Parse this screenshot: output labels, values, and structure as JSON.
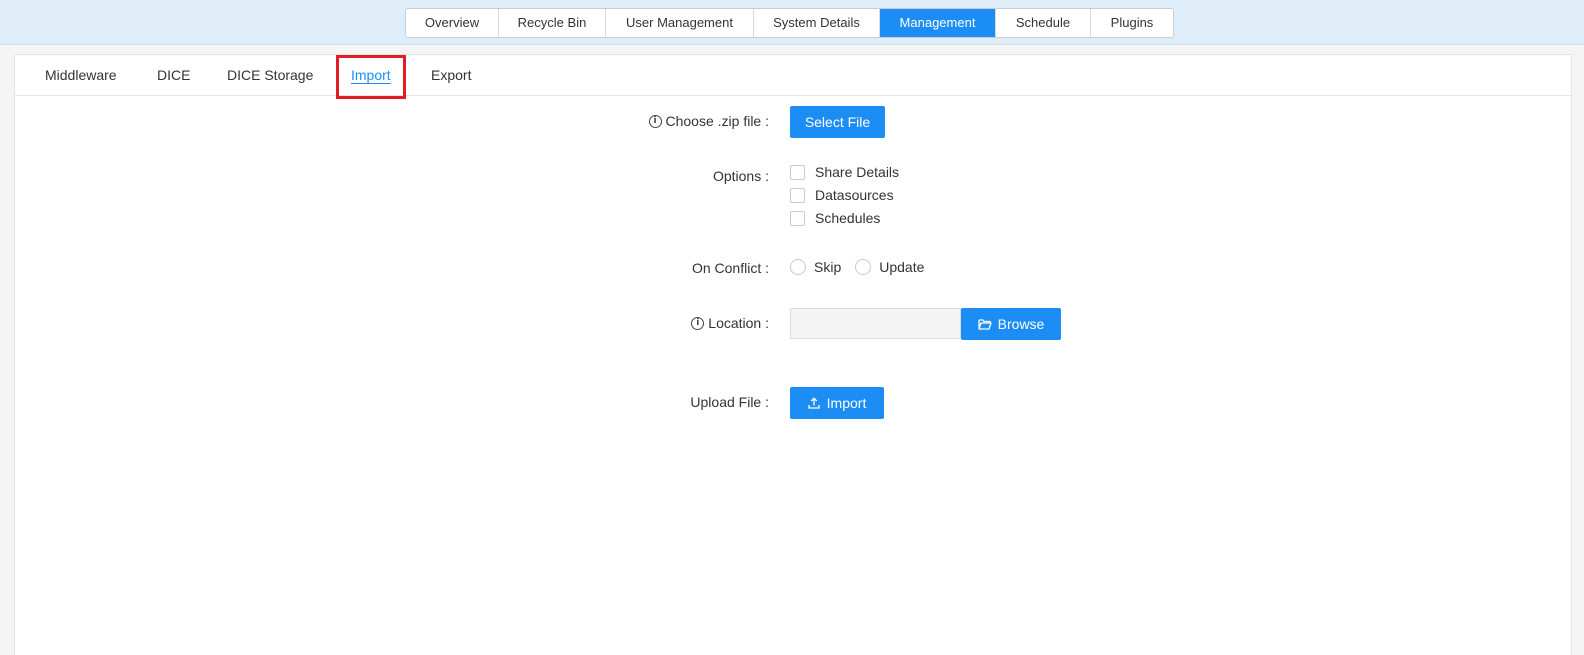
{
  "top_tabs": [
    {
      "label": "Overview"
    },
    {
      "label": "Recycle Bin"
    },
    {
      "label": "User Management"
    },
    {
      "label": "System Details"
    },
    {
      "label": "Management",
      "active": true
    },
    {
      "label": "Schedule"
    },
    {
      "label": "Plugins"
    }
  ],
  "sub_tabs": [
    {
      "label": "Middleware"
    },
    {
      "label": "DICE"
    },
    {
      "label": "DICE Storage"
    },
    {
      "label": "Import",
      "active": true
    },
    {
      "label": "Export"
    }
  ],
  "form": {
    "choose_zip": {
      "label": "Choose .zip file :",
      "button": "Select File"
    },
    "options": {
      "label": "Options :",
      "items": [
        "Share Details",
        "Datasources",
        "Schedules"
      ]
    },
    "on_conflict": {
      "label": "On Conflict :",
      "choices": [
        "Skip",
        "Update"
      ]
    },
    "location": {
      "label": "Location :",
      "value": "",
      "button": "Browse"
    },
    "upload": {
      "label": "Upload File :",
      "button": "Import"
    }
  },
  "colors": {
    "accent": "#1c8df5",
    "highlight": "#e01e24",
    "top_bar": "#deedf8"
  },
  "icons": {
    "info": "info-icon",
    "folder": "folder-open-icon",
    "upload": "upload-icon"
  }
}
